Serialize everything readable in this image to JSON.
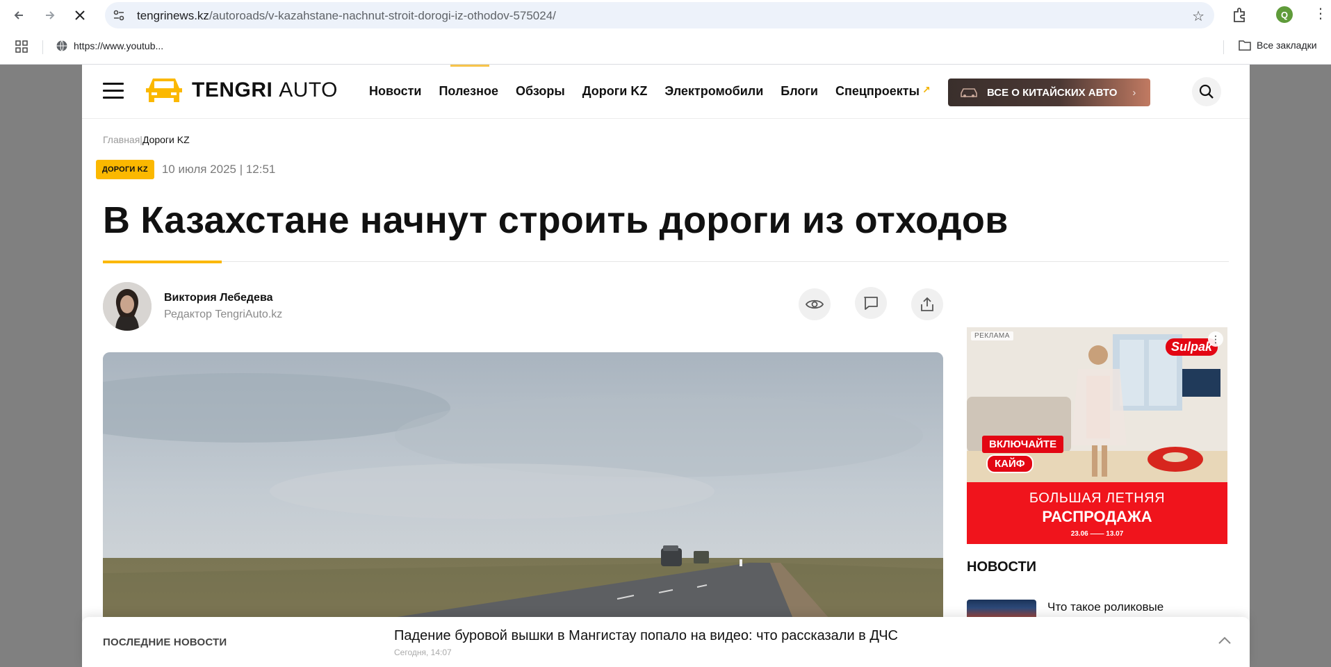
{
  "browser": {
    "url_host": "tengrinews.kz",
    "url_path": "/autoroads/v-kazahstane-nachnut-stroit-dorogi-iz-othodov-575024/",
    "profile_initial": "Q",
    "bookmark_label": "https://www.youtub...",
    "all_bookmarks_label": "Все закладки"
  },
  "header": {
    "logo_bold": "TENGRI",
    "logo_light": "AUTO",
    "nav": [
      "Новости",
      "Полезное",
      "Обзоры",
      "Дороги KZ",
      "Электромобили",
      "Блоги",
      "Спецпроекты"
    ],
    "special_arrow": "↗",
    "promo_button": "ВСЕ О КИТАЙСКИХ АВТО",
    "promo_chevron": "›",
    "accent_color": "#fbb800"
  },
  "breadcrumb": {
    "home": "Главная",
    "separator": "|",
    "current": "Дороги KZ"
  },
  "article": {
    "tag": "ДОРОГИ KZ",
    "date": "10 июля 2025 | 12:51",
    "title": "В Казахстане начнут строить дороги из отходов",
    "author_name": "Виктория Лебедева",
    "author_role": "Редактор TengriAuto.kz",
    "actions": [
      "eye-icon",
      "comment-icon",
      "share-icon"
    ]
  },
  "ad": {
    "label": "РЕКЛАМА",
    "more": "⋮",
    "brand": "Sulpak",
    "badge1": "ВКЛЮЧАЙТЕ",
    "badge2": "КАЙФ",
    "line1": "БОЛЬШАЯ ЛЕТНЯЯ",
    "line2": "РАСПРОДАЖА",
    "dates": "23.06 —— 13.07"
  },
  "sidebar": {
    "news_heading": "НОВОСТИ",
    "first_news_title": "Что такое роликовые"
  },
  "ticker": {
    "label": "ПОСЛЕДНИЕ НОВОСТИ",
    "headline": "Падение буровой вышки в Мангистау попало на видео: что рассказали в ДЧС",
    "time": "Сегодня, 14:07"
  }
}
